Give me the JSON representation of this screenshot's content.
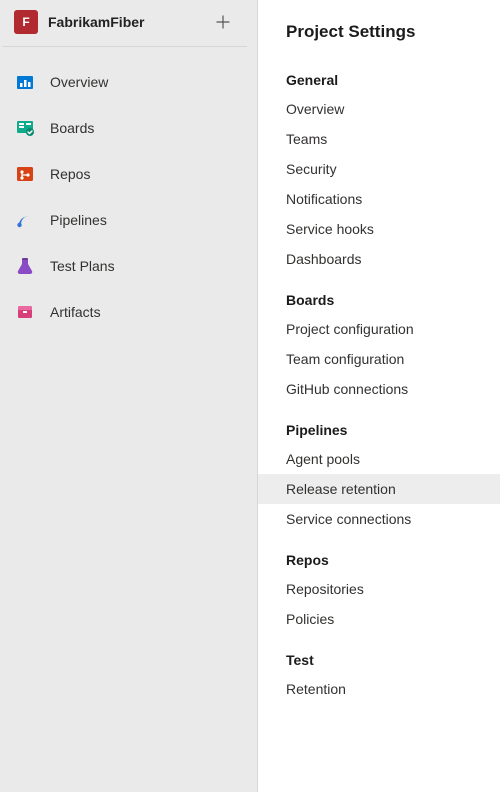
{
  "sidebar": {
    "project_initial": "F",
    "project_name": "FabrikamFiber",
    "items": [
      {
        "label": "Overview",
        "icon": "overview"
      },
      {
        "label": "Boards",
        "icon": "boards"
      },
      {
        "label": "Repos",
        "icon": "repos"
      },
      {
        "label": "Pipelines",
        "icon": "pipelines"
      },
      {
        "label": "Test Plans",
        "icon": "testplans"
      },
      {
        "label": "Artifacts",
        "icon": "artifacts"
      }
    ]
  },
  "panel": {
    "title": "Project Settings",
    "sections": [
      {
        "heading": "General",
        "items": [
          "Overview",
          "Teams",
          "Security",
          "Notifications",
          "Service hooks",
          "Dashboards"
        ]
      },
      {
        "heading": "Boards",
        "items": [
          "Project configuration",
          "Team configuration",
          "GitHub connections"
        ]
      },
      {
        "heading": "Pipelines",
        "items": [
          "Agent pools",
          "Release retention",
          "Service connections"
        ],
        "selected": "Release retention"
      },
      {
        "heading": "Repos",
        "items": [
          "Repositories",
          "Policies"
        ]
      },
      {
        "heading": "Test",
        "items": [
          "Retention"
        ]
      }
    ]
  }
}
